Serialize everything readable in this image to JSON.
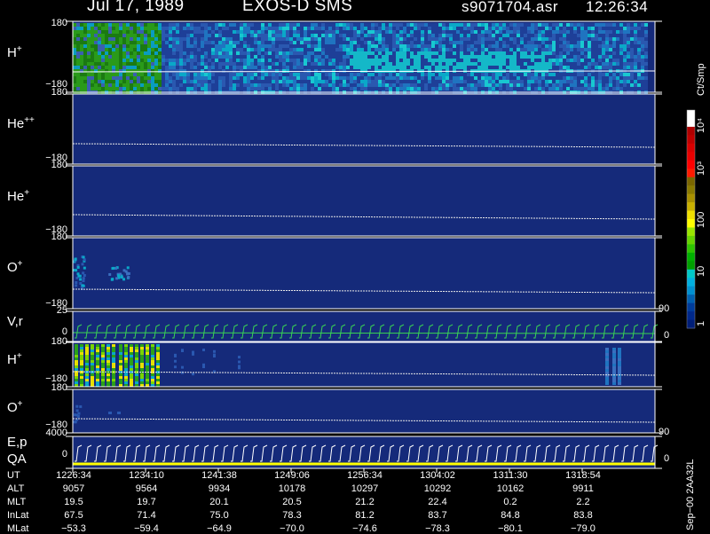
{
  "header": {
    "date": "Jul 17, 1989",
    "instrument": "EXOS-D SMS",
    "file": "s9071704.asr",
    "time": "12:26:34"
  },
  "panels": [
    {
      "label_main": "H",
      "label_sup": "+",
      "ymax": "180",
      "ymin": "−180"
    },
    {
      "label_main": "He",
      "label_sup": "++",
      "ymax": "180",
      "ymin": "−180"
    },
    {
      "label_main": "He",
      "label_sup": "+",
      "ymax": "180",
      "ymin": "−180"
    },
    {
      "label_main": "O",
      "label_sup": "+",
      "ymax": "180",
      "ymin": "−180",
      "right_tick": "90"
    },
    {
      "label_main": "V,r",
      "label_sup": "",
      "ymax": "25",
      "ymin": "0",
      "right_tick": "0"
    },
    {
      "label_main": "H",
      "label_sup": "+",
      "ymax": "180",
      "ymin": "−180"
    },
    {
      "label_main": "O",
      "label_sup": "+",
      "ymax": "180",
      "ymin": "−180",
      "right_tick": "90"
    },
    {
      "label_main": "E,p",
      "label_sup": "",
      "label2": "QA",
      "ymax": "4000",
      "ymin": "0",
      "right_tick": "0"
    }
  ],
  "colorbar": {
    "unit": "Ct/Smp",
    "ticks": [
      "10⁴",
      "10³",
      "100",
      "10",
      "1"
    ],
    "colors": [
      "#ffffff",
      "#ffffff",
      "#b00000",
      "#c00000",
      "#d80000",
      "#e80000",
      "#ff0000",
      "#ff1a00",
      "#7a6600",
      "#8a7a00",
      "#a89000",
      "#c8b000",
      "#f0e000",
      "#ffff00",
      "#9ae600",
      "#66d400",
      "#2ec400",
      "#00b000",
      "#00a000",
      "#00c8c8",
      "#00b0e0",
      "#0090d0",
      "#0060b0",
      "#003c9a",
      "#00288a",
      "#001e78"
    ]
  },
  "footer": {
    "row_labels": [
      "UT",
      "ALT",
      "MLT",
      "InLat",
      "MLat"
    ],
    "columns": [
      [
        "1226:34",
        "9057",
        "19.5",
        "67.5",
        "−53.3"
      ],
      [
        "1234:10",
        "9564",
        "19.7",
        "71.4",
        "−59.4"
      ],
      [
        "1241:38",
        "9934",
        "20.1",
        "75.0",
        "−64.9"
      ],
      [
        "1249:06",
        "10178",
        "20.5",
        "78.3",
        "−70.0"
      ],
      [
        "1256:34",
        "10297",
        "21.2",
        "81.2",
        "−74.6"
      ],
      [
        "1304:02",
        "10292",
        "22.4",
        "83.7",
        "−78.3"
      ],
      [
        "1311:30",
        "10162",
        "0.2",
        "84.8",
        "−80.1"
      ],
      [
        "1318:54",
        "9911",
        "2.2",
        "83.8",
        "−79.0"
      ]
    ],
    "processing_note": "Sep−00 2AA32L"
  },
  "chart_data": {
    "type": "heatmap",
    "x_ticks": [
      "1226:34",
      "1234:10",
      "1241:38",
      "1249:06",
      "1256:34",
      "1304:02",
      "1311:30",
      "1318:54"
    ],
    "panels": [
      {
        "name": "H+",
        "ylim": [
          -180,
          180
        ]
      },
      {
        "name": "He++",
        "ylim": [
          -180,
          180
        ]
      },
      {
        "name": "He+",
        "ylim": [
          -180,
          180
        ]
      },
      {
        "name": "O+",
        "ylim": [
          -180,
          180
        ]
      },
      {
        "name": "V,r",
        "ylim": [
          0,
          25
        ]
      },
      {
        "name": "H+",
        "ylim": [
          -180,
          180
        ]
      },
      {
        "name": "O+",
        "ylim": [
          -180,
          180
        ]
      },
      {
        "name": "E,p / QA",
        "ylim": [
          0,
          4000
        ]
      }
    ],
    "colorbar": {
      "unit": "Ct/Smp",
      "scale": "log",
      "range": [
        1,
        10000
      ]
    }
  }
}
